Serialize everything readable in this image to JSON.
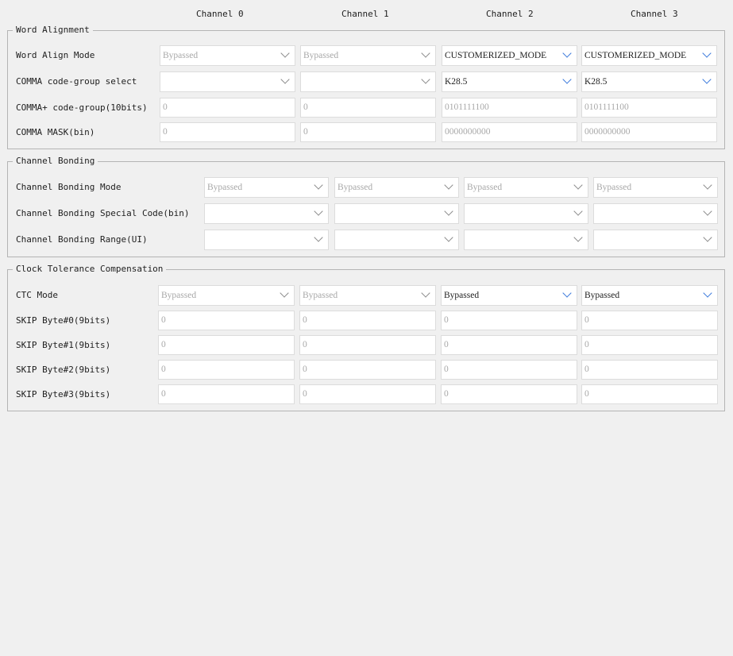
{
  "channels": [
    "Channel 0",
    "Channel 1",
    "Channel 2",
    "Channel 3"
  ],
  "word_alignment": {
    "title": "Word Alignment",
    "rows": [
      {
        "label": "Word Align Mode",
        "kind": "select",
        "cells": [
          {
            "value": "Bypassed",
            "enabled": false
          },
          {
            "value": "Bypassed",
            "enabled": false
          },
          {
            "value": "CUSTOMERIZED_MODE",
            "enabled": true
          },
          {
            "value": "CUSTOMERIZED_MODE",
            "enabled": true
          }
        ]
      },
      {
        "label": "COMMA code-group select",
        "kind": "select",
        "cells": [
          {
            "value": "",
            "enabled": false
          },
          {
            "value": "",
            "enabled": false
          },
          {
            "value": "K28.5",
            "enabled": true
          },
          {
            "value": "K28.5",
            "enabled": true
          }
        ]
      },
      {
        "label": "COMMA+ code-group(10bits)",
        "kind": "input",
        "cells": [
          {
            "value": "0",
            "enabled": false
          },
          {
            "value": "0",
            "enabled": false
          },
          {
            "value": "0101111100",
            "enabled": false
          },
          {
            "value": "0101111100",
            "enabled": false
          }
        ]
      },
      {
        "label": "COMMA MASK(bin)",
        "kind": "input",
        "cells": [
          {
            "value": "0",
            "enabled": false
          },
          {
            "value": "0",
            "enabled": false
          },
          {
            "value": "0000000000",
            "enabled": false
          },
          {
            "value": "0000000000",
            "enabled": false
          }
        ]
      }
    ]
  },
  "channel_bonding": {
    "title": "Channel Bonding",
    "rows": [
      {
        "label": "Channel Bonding Mode",
        "kind": "select",
        "cells": [
          {
            "value": "Bypassed",
            "enabled": false
          },
          {
            "value": "Bypassed",
            "enabled": false
          },
          {
            "value": "Bypassed",
            "enabled": false
          },
          {
            "value": "Bypassed",
            "enabled": false
          }
        ]
      },
      {
        "label": "Channel Bonding Special Code(bin)",
        "kind": "select",
        "cells": [
          {
            "value": "",
            "enabled": false
          },
          {
            "value": "",
            "enabled": false
          },
          {
            "value": "",
            "enabled": false
          },
          {
            "value": "",
            "enabled": false
          }
        ]
      },
      {
        "label": "Channel Bonding Range(UI)",
        "kind": "select",
        "cells": [
          {
            "value": "",
            "enabled": false
          },
          {
            "value": "",
            "enabled": false
          },
          {
            "value": "",
            "enabled": false
          },
          {
            "value": "",
            "enabled": false
          }
        ]
      }
    ]
  },
  "clock_tolerance": {
    "title": "Clock Tolerance Compensation",
    "rows": [
      {
        "label": "CTC Mode",
        "kind": "select",
        "cells": [
          {
            "value": "Bypassed",
            "enabled": false
          },
          {
            "value": "Bypassed",
            "enabled": false
          },
          {
            "value": "Bypassed",
            "enabled": true
          },
          {
            "value": "Bypassed",
            "enabled": true
          }
        ]
      },
      {
        "label": "SKIP Byte#0(9bits)",
        "kind": "input",
        "cells": [
          {
            "value": "0",
            "enabled": false
          },
          {
            "value": "0",
            "enabled": false
          },
          {
            "value": "0",
            "enabled": false
          },
          {
            "value": "0",
            "enabled": false
          }
        ]
      },
      {
        "label": "SKIP Byte#1(9bits)",
        "kind": "input",
        "cells": [
          {
            "value": "0",
            "enabled": false
          },
          {
            "value": "0",
            "enabled": false
          },
          {
            "value": "0",
            "enabled": false
          },
          {
            "value": "0",
            "enabled": false
          }
        ]
      },
      {
        "label": "SKIP Byte#2(9bits)",
        "kind": "input",
        "cells": [
          {
            "value": "0",
            "enabled": false
          },
          {
            "value": "0",
            "enabled": false
          },
          {
            "value": "0",
            "enabled": false
          },
          {
            "value": "0",
            "enabled": false
          }
        ]
      },
      {
        "label": "SKIP Byte#3(9bits)",
        "kind": "input",
        "cells": [
          {
            "value": "0",
            "enabled": false
          },
          {
            "value": "0",
            "enabled": false
          },
          {
            "value": "0",
            "enabled": false
          },
          {
            "value": "0",
            "enabled": false
          }
        ]
      }
    ]
  }
}
